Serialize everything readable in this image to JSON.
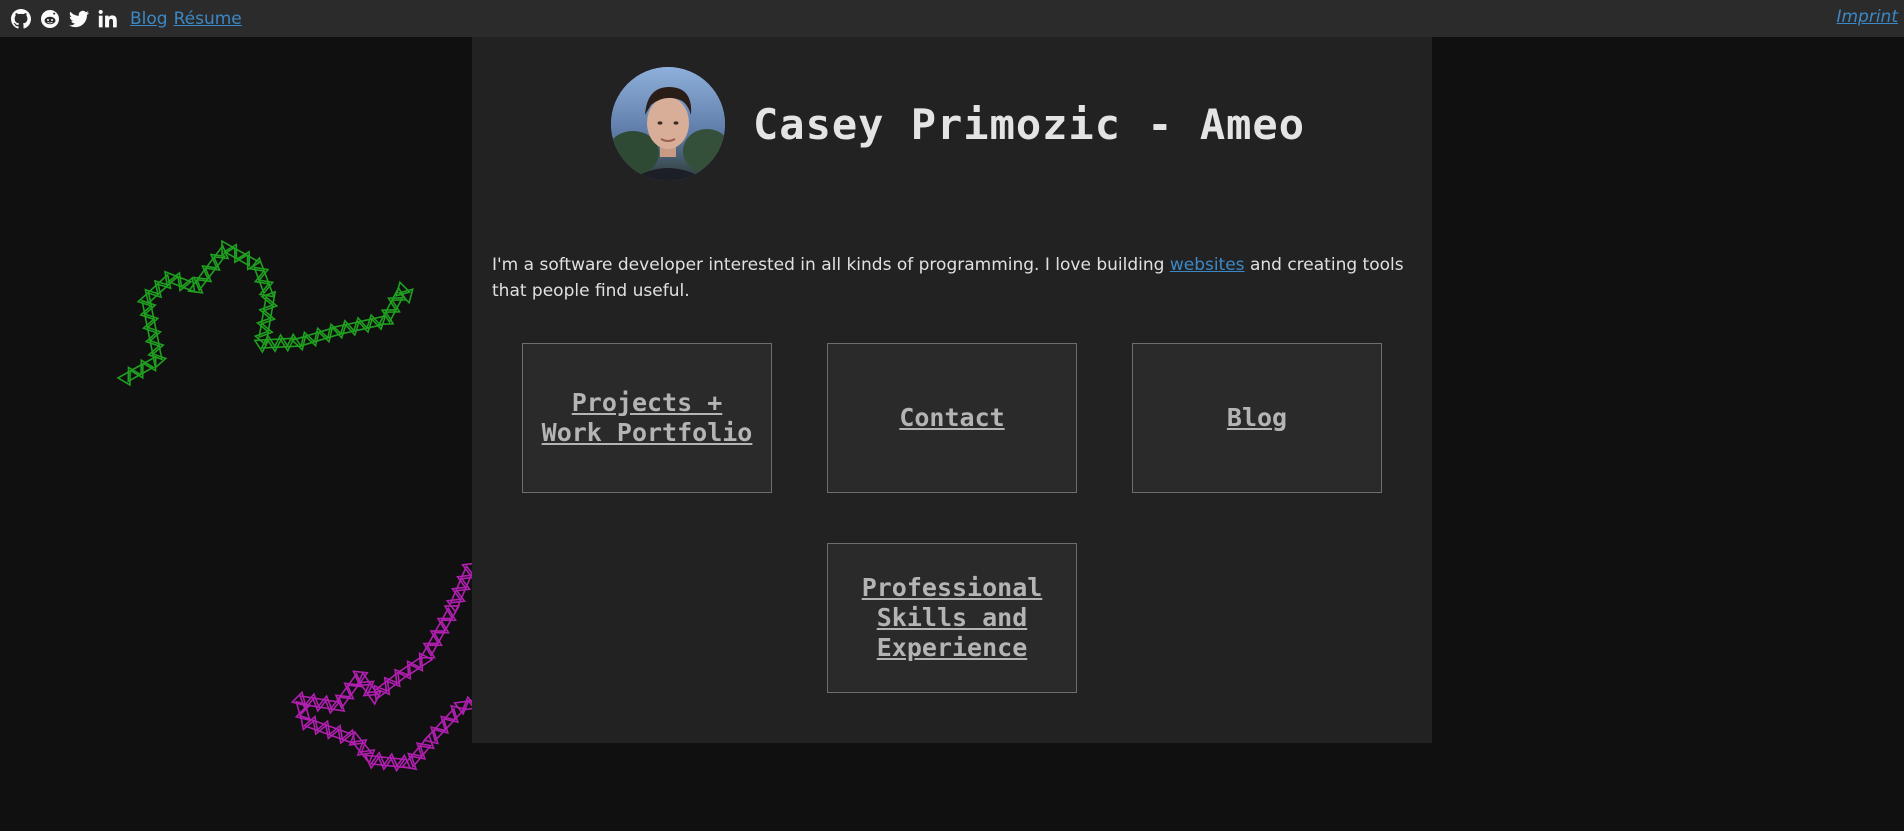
{
  "topbar": {
    "icons": [
      "github-icon",
      "reddit-icon",
      "twitter-icon",
      "linkedin-icon"
    ],
    "blog_link": "Blog",
    "resume_link": "Résume",
    "imprint_link": "Imprint"
  },
  "header": {
    "title": "Casey Primozic - Ameo"
  },
  "intro": {
    "text_before": "I'm a software developer interested in all kinds of programming. I love building ",
    "link": "websites",
    "text_after": " and creating tools that people find useful."
  },
  "tiles": [
    {
      "label": "Projects +\nWork Portfolio"
    },
    {
      "label": "Contact"
    },
    {
      "label": "Blog"
    },
    {
      "label": "Professional\nSkills and\nExperience"
    }
  ],
  "colors": {
    "background": "#101010",
    "topbar": "#2b2b2b",
    "content": "#222222",
    "link": "#3c88c6",
    "decor_green": "#1fa01f",
    "decor_magenta": "#b01fb0",
    "decor_teal": "#1d3a3e"
  }
}
